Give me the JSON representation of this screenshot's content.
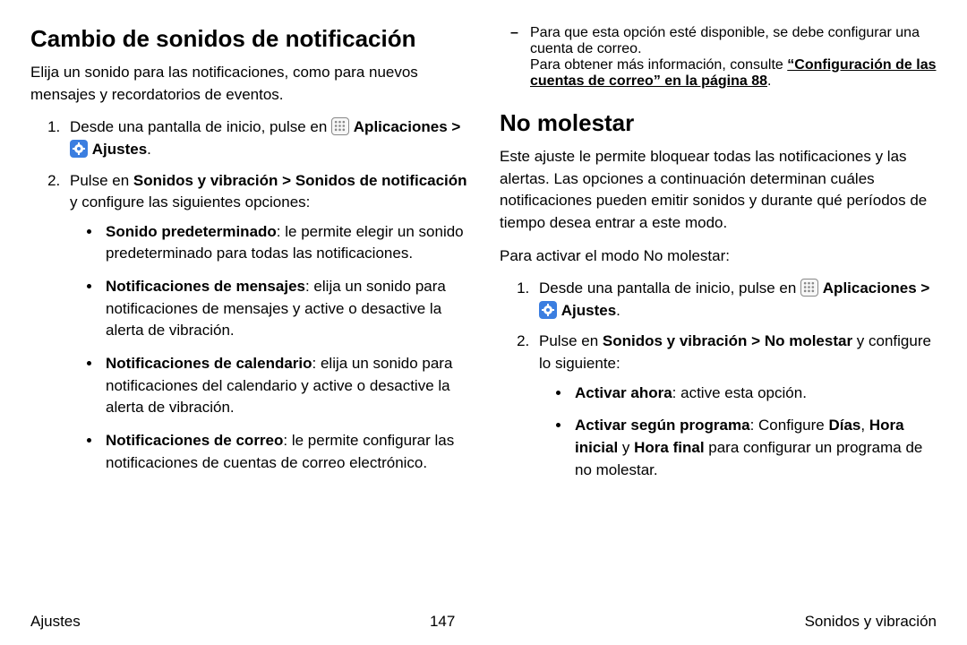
{
  "left": {
    "title": "Cambio de sonidos de notificación",
    "intro": "Elija un sonido para las notificaciones, como para nuevos mensajes y recordatorios de eventos.",
    "step1_a": "Desde una pantalla de inicio, pulse en ",
    "apps": "Aplicaciones",
    "gt": " > ",
    "settings": "Ajustes",
    "dot": ".",
    "step2_a": "Pulse en ",
    "step2_b": "Sonidos y vibración",
    "step2_c": " > ",
    "step2_d": "Sonidos de notificación",
    "step2_e": " y configure las siguientes opciones:",
    "bul1_b": "Sonido predeterminado",
    "bul1_r": ": le permite elegir un sonido predeterminado para todas las notificaciones.",
    "bul2_b": "Notificaciones de mensajes",
    "bul2_r": ": elija un sonido para notificaciones de mensajes y active o desactive la alerta de vibración.",
    "bul3_b": "Notificaciones de calendario",
    "bul3_r": ": elija un sonido para notificaciones del calendario y active o desactive la alerta de vibración.",
    "bul4_b": "Notificaciones de correo",
    "bul4_r": ": le permite configurar las notificaciones de cuentas de correo electrónico."
  },
  "right": {
    "dash_a": "Para que esta opción esté disponible, se debe configurar una cuenta de correo.",
    "dash_b": "Para obtener más información, consulte ",
    "dash_link": "“Configuración de las cuentas de correo” en la página 88",
    "dash_c": ".",
    "h2": "No molestar",
    "p1": "Este ajuste le permite bloquear todas las notificaciones y las alertas. Las opciones a continuación determinan cuáles notificaciones pueden emitir sonidos y durante qué períodos de tiempo desea entrar a este modo.",
    "p2": "Para activar el modo No molestar:",
    "step1_a": "Desde una pantalla de inicio, pulse en ",
    "apps": "Aplicaciones",
    "gt": " > ",
    "settings": "Ajustes",
    "dot": ".",
    "step2_a": "Pulse en ",
    "step2_b": "Sonidos y vibración",
    "step2_c": " > ",
    "step2_d": "No molestar",
    "step2_e": " y configure lo siguiente:",
    "bul1_b": "Activar ahora",
    "bul1_r": ": active esta opción.",
    "bul2_b": "Activar según programa",
    "bul2_r1": ": Configure ",
    "bul2_b2": "Días",
    "bul2_r2": ",  ",
    "bul2_b3": "Hora inicial",
    "bul2_r3": " y ",
    "bul2_b4": "Hora final",
    "bul2_r4": " para configurar un programa de no molestar."
  },
  "footer": {
    "left": "Ajustes",
    "center": "147",
    "right": "Sonidos y vibración"
  }
}
